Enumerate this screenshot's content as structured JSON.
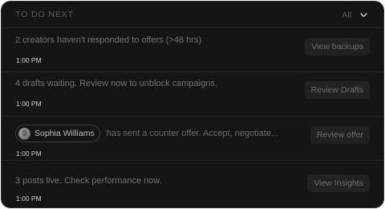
{
  "header": {
    "title": "TO DO NEXT",
    "filter_label": "All",
    "filter_icon": "chevron-down-icon"
  },
  "tasks": [
    {
      "text": "2 creators haven't responded to offers (>48 hrs)",
      "time": "1:00 PM",
      "action": "View backups"
    },
    {
      "text": "4 drafts waiting. Review now to unblock campaigns.",
      "time": "1:00 PM",
      "action": "Review Drafts"
    },
    {
      "person": "Sophia Williams",
      "text": "has sent a counter offer. Accept, negotiate...",
      "time": "1:00 PM",
      "action": "Review offer"
    },
    {
      "text": "3 posts live. Check performance now.",
      "time": "1:00 PM",
      "action": "View Insights"
    }
  ]
}
